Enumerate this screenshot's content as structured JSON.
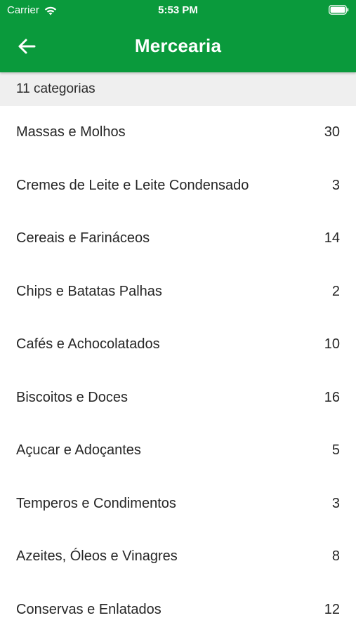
{
  "status_bar": {
    "carrier": "Carrier",
    "time": "5:53 PM",
    "icons": [
      "wifi-icon",
      "battery-icon"
    ]
  },
  "nav": {
    "title": "Mercearia",
    "back_icon": "arrow-left-icon"
  },
  "colors": {
    "primary": "#0a9a3c",
    "section_bg": "#efefef",
    "text": "#262626"
  },
  "section_header": "11 categorias",
  "categories": [
    {
      "label": "Massas e Molhos",
      "count": "30"
    },
    {
      "label": "Cremes de Leite e Leite Condensado",
      "count": "3"
    },
    {
      "label": "Cereais e Farináceos",
      "count": "14"
    },
    {
      "label": "Chips e Batatas Palhas",
      "count": "2"
    },
    {
      "label": "Cafés e Achocolatados",
      "count": "10"
    },
    {
      "label": "Biscoitos e Doces",
      "count": "16"
    },
    {
      "label": "Açucar e Adoçantes",
      "count": "5"
    },
    {
      "label": "Temperos e Condimentos",
      "count": "3"
    },
    {
      "label": "Azeites, Óleos e Vinagres",
      "count": "8"
    },
    {
      "label": "Conservas e Enlatados",
      "count": "12"
    }
  ]
}
